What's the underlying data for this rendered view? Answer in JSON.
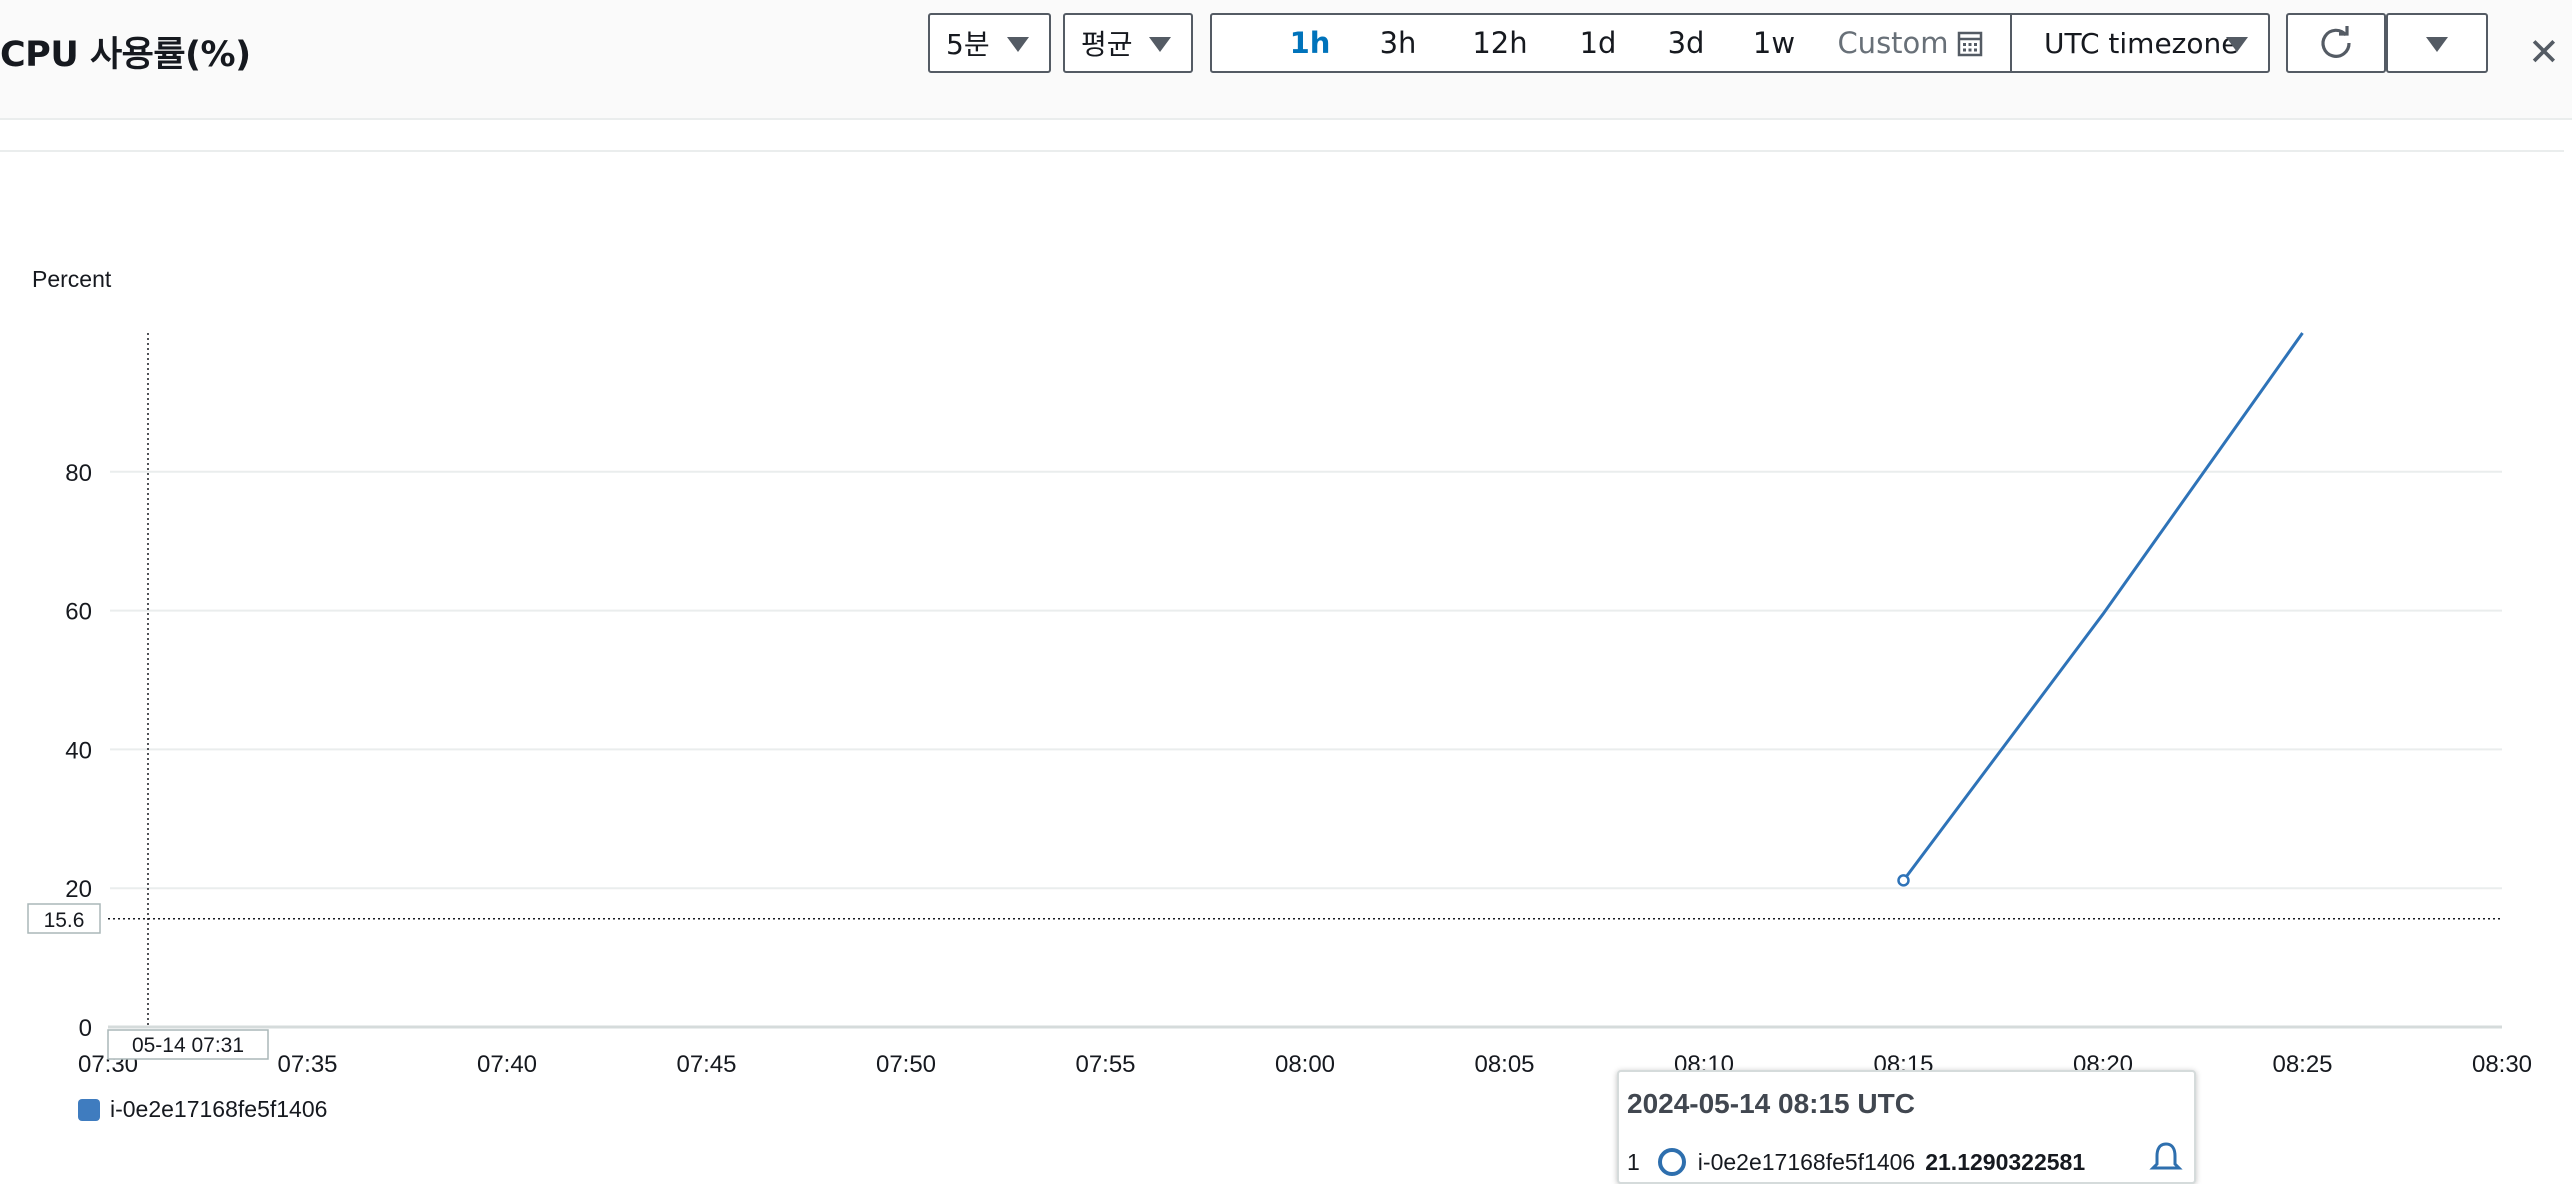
{
  "widget": {
    "title": "CPU 사용률(%)",
    "period": "5분",
    "statistic": "평균",
    "time_ranges": [
      "1h",
      "3h",
      "12h",
      "1d",
      "3d",
      "1w"
    ],
    "active_range": "1h",
    "custom_label": "Custom",
    "timezone": "UTC timezone",
    "icons": {
      "refresh": "refresh-icon",
      "menu": "caret-down-icon",
      "close": "close-icon",
      "calendar": "calendar-icon",
      "bell": "bell-icon"
    }
  },
  "chart_data": {
    "type": "line",
    "ylabel": "Percent",
    "ylim": [
      0,
      100
    ],
    "ytick_labels": [
      "0",
      "20",
      "40",
      "60",
      "80"
    ],
    "xtick_labels": [
      "07:30",
      "07:35",
      "07:40",
      "07:45",
      "07:50",
      "07:55",
      "08:00",
      "08:05",
      "08:10",
      "08:15",
      "08:20",
      "08:25",
      "08:30"
    ],
    "series": [
      {
        "name": "i-0e2e17168fe5f1406",
        "color": "#2e73b8",
        "x": [
          "08:15",
          "08:20",
          "08:25"
        ],
        "y": [
          21.13,
          59.5,
          100
        ]
      }
    ],
    "crosshair": {
      "x_label": "05-14 07:31",
      "y_label": "15.6",
      "y_value": 15.6
    },
    "grid": true,
    "legend": "bottom-left"
  },
  "legend": {
    "series_label": "i-0e2e17168fe5f1406"
  },
  "tooltip": {
    "title": "2024-05-14 08:15 UTC",
    "index": "1",
    "series": "i-0e2e17168fe5f1406",
    "value": "21.1290322581"
  }
}
